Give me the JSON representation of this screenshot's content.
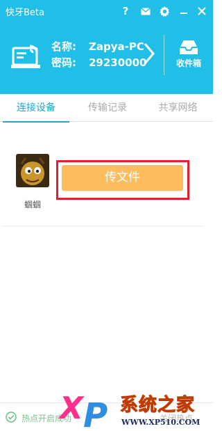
{
  "app": {
    "title": "快牙Beta"
  },
  "titlebar": {
    "help_icon": "question-icon",
    "mail_icon": "mail-icon",
    "settings_icon": "gear-icon",
    "minimize_icon": "minimize-icon",
    "close_icon": "close-icon"
  },
  "device": {
    "name_label": "名称:",
    "name_value": "Zapya-PC",
    "password_label": "密码:",
    "password_value": "29230000",
    "icon": "wifi-laptop-icon"
  },
  "inbox": {
    "label": "收件箱",
    "icon": "inbox-icon"
  },
  "tabs": [
    {
      "label": "连接设备",
      "active": true
    },
    {
      "label": "传输记录",
      "active": false
    },
    {
      "label": "共享网络",
      "active": false
    }
  ],
  "connected": {
    "user_name": "蝈蝈",
    "send_label": "传文件"
  },
  "status": {
    "text": "热点开启成功",
    "link": "关闭热点"
  },
  "watermark": {
    "brand_x": "X",
    "brand_p": "P",
    "title": "系统之家",
    "url": "WWW.XP510.COM"
  },
  "colors": {
    "header": "#21bfe8",
    "accent": "#21a5d6",
    "send_button": "#fdbd5e",
    "highlight": "#e0202a"
  }
}
